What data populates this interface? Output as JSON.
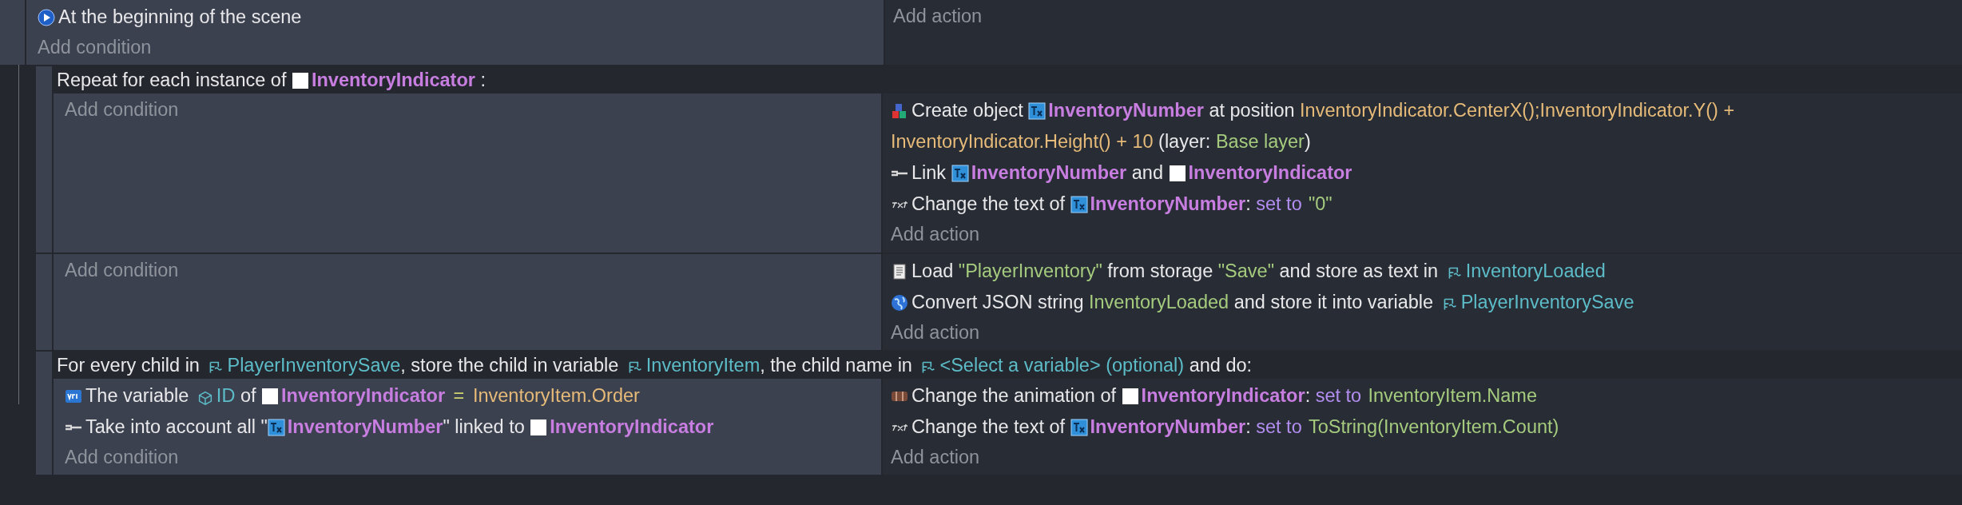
{
  "events": [
    {
      "kind": "standard",
      "conditions": [
        {
          "kind": "scene_start",
          "parts": [
            {
              "kind": "plain",
              "text": "At the beginning of the scene"
            }
          ]
        }
      ],
      "add_condition": "Add condition",
      "add_action": "Add action",
      "children": [
        {
          "kind": "repeat",
          "header": [
            {
              "kind": "plain",
              "text": "Repeat for each instance of "
            },
            {
              "kind": "object_sprite",
              "text": "InventoryIndicator"
            },
            {
              "kind": "plain",
              "text": " :"
            }
          ],
          "add_condition": "Add condition",
          "actions": [
            {
              "kind": "create",
              "parts": [
                {
                  "kind": "plain",
                  "text": "Create object "
                },
                {
                  "kind": "object_text",
                  "text": "InventoryNumber"
                },
                {
                  "kind": "plain",
                  "text": " at position "
                },
                {
                  "kind": "expression",
                  "text": "InventoryIndicator.CenterX();InventoryIndicator.Y() +"
                },
                {
                  "kind": "expression",
                  "text": "InventoryIndicator.Height() + 10"
                },
                {
                  "kind": "plain",
                  "text": " (layer: "
                },
                {
                  "kind": "string",
                  "text": "Base layer"
                },
                {
                  "kind": "plain",
                  "text": ")"
                }
              ]
            },
            {
              "kind": "link",
              "parts": [
                {
                  "kind": "plain",
                  "text": "Link "
                },
                {
                  "kind": "object_text",
                  "text": "InventoryNumber"
                },
                {
                  "kind": "plain",
                  "text": " and "
                },
                {
                  "kind": "object_sprite",
                  "text": "InventoryIndicator"
                }
              ]
            },
            {
              "kind": "text",
              "parts": [
                {
                  "kind": "plain",
                  "text": "Change the text of "
                },
                {
                  "kind": "object_text",
                  "text": "InventoryNumber"
                },
                {
                  "kind": "plain",
                  "text": ": "
                },
                {
                  "kind": "keyword",
                  "text": "set to"
                },
                {
                  "kind": "string",
                  "text": "\"0\""
                }
              ]
            }
          ],
          "add_action": "Add action"
        },
        {
          "kind": "standard",
          "add_condition": "Add condition",
          "actions": [
            {
              "kind": "storage",
              "parts": [
                {
                  "kind": "plain",
                  "text": "Load "
                },
                {
                  "kind": "string",
                  "text": "\"PlayerInventory\""
                },
                {
                  "kind": "plain",
                  "text": " from storage "
                },
                {
                  "kind": "string",
                  "text": "\"Save\""
                },
                {
                  "kind": "plain",
                  "text": " and store as text in "
                },
                {
                  "kind": "variable",
                  "text": "InventoryLoaded"
                }
              ]
            },
            {
              "kind": "json",
              "parts": [
                {
                  "kind": "plain",
                  "text": "Convert JSON string "
                },
                {
                  "kind": "string",
                  "text": "InventoryLoaded"
                },
                {
                  "kind": "plain",
                  "text": " and store it into variable "
                },
                {
                  "kind": "variable",
                  "text": "PlayerInventorySave"
                }
              ]
            }
          ],
          "add_action": "Add action"
        },
        {
          "kind": "for_each_child",
          "header": [
            {
              "kind": "plain",
              "text": "For every child in "
            },
            {
              "kind": "variable",
              "text": "PlayerInventorySave"
            },
            {
              "kind": "plain",
              "text": ", store the child in variable "
            },
            {
              "kind": "variable",
              "text": "InventoryItem"
            },
            {
              "kind": "plain",
              "text": ", the child name in "
            },
            {
              "kind": "variable",
              "text": "<Select a variable> (optional)"
            },
            {
              "kind": "plain",
              "text": " and do:"
            }
          ],
          "conditions": [
            {
              "kind": "variable",
              "parts": [
                {
                  "kind": "plain",
                  "text": "The variable "
                },
                {
                  "kind": "object_variable",
                  "text": "ID"
                },
                {
                  "kind": "plain",
                  "text": " of "
                },
                {
                  "kind": "object_sprite",
                  "text": "InventoryIndicator"
                },
                {
                  "kind": "operator",
                  "text": "="
                },
                {
                  "kind": "expression",
                  "text": "InventoryItem.Order"
                }
              ]
            },
            {
              "kind": "link",
              "parts": [
                {
                  "kind": "plain",
                  "text": "Take into account all \""
                },
                {
                  "kind": "object_text",
                  "text": "InventoryNumber"
                },
                {
                  "kind": "plain",
                  "text": "\" linked to "
                },
                {
                  "kind": "object_sprite",
                  "text": "InventoryIndicator"
                }
              ]
            }
          ],
          "add_condition": "Add condition",
          "actions": [
            {
              "kind": "animation",
              "parts": [
                {
                  "kind": "plain",
                  "text": "Change the animation of "
                },
                {
                  "kind": "object_sprite",
                  "text": "InventoryIndicator"
                },
                {
                  "kind": "plain",
                  "text": ": "
                },
                {
                  "kind": "keyword",
                  "text": "set to"
                },
                {
                  "kind": "string",
                  "text": "InventoryItem.Name"
                }
              ]
            },
            {
              "kind": "text",
              "parts": [
                {
                  "kind": "plain",
                  "text": "Change the text of "
                },
                {
                  "kind": "object_text",
                  "text": "InventoryNumber"
                },
                {
                  "kind": "plain",
                  "text": ": "
                },
                {
                  "kind": "keyword",
                  "text": "set to"
                },
                {
                  "kind": "string",
                  "text": "ToString(InventoryItem.Count)"
                }
              ]
            }
          ],
          "add_action": "Add action"
        }
      ]
    }
  ]
}
